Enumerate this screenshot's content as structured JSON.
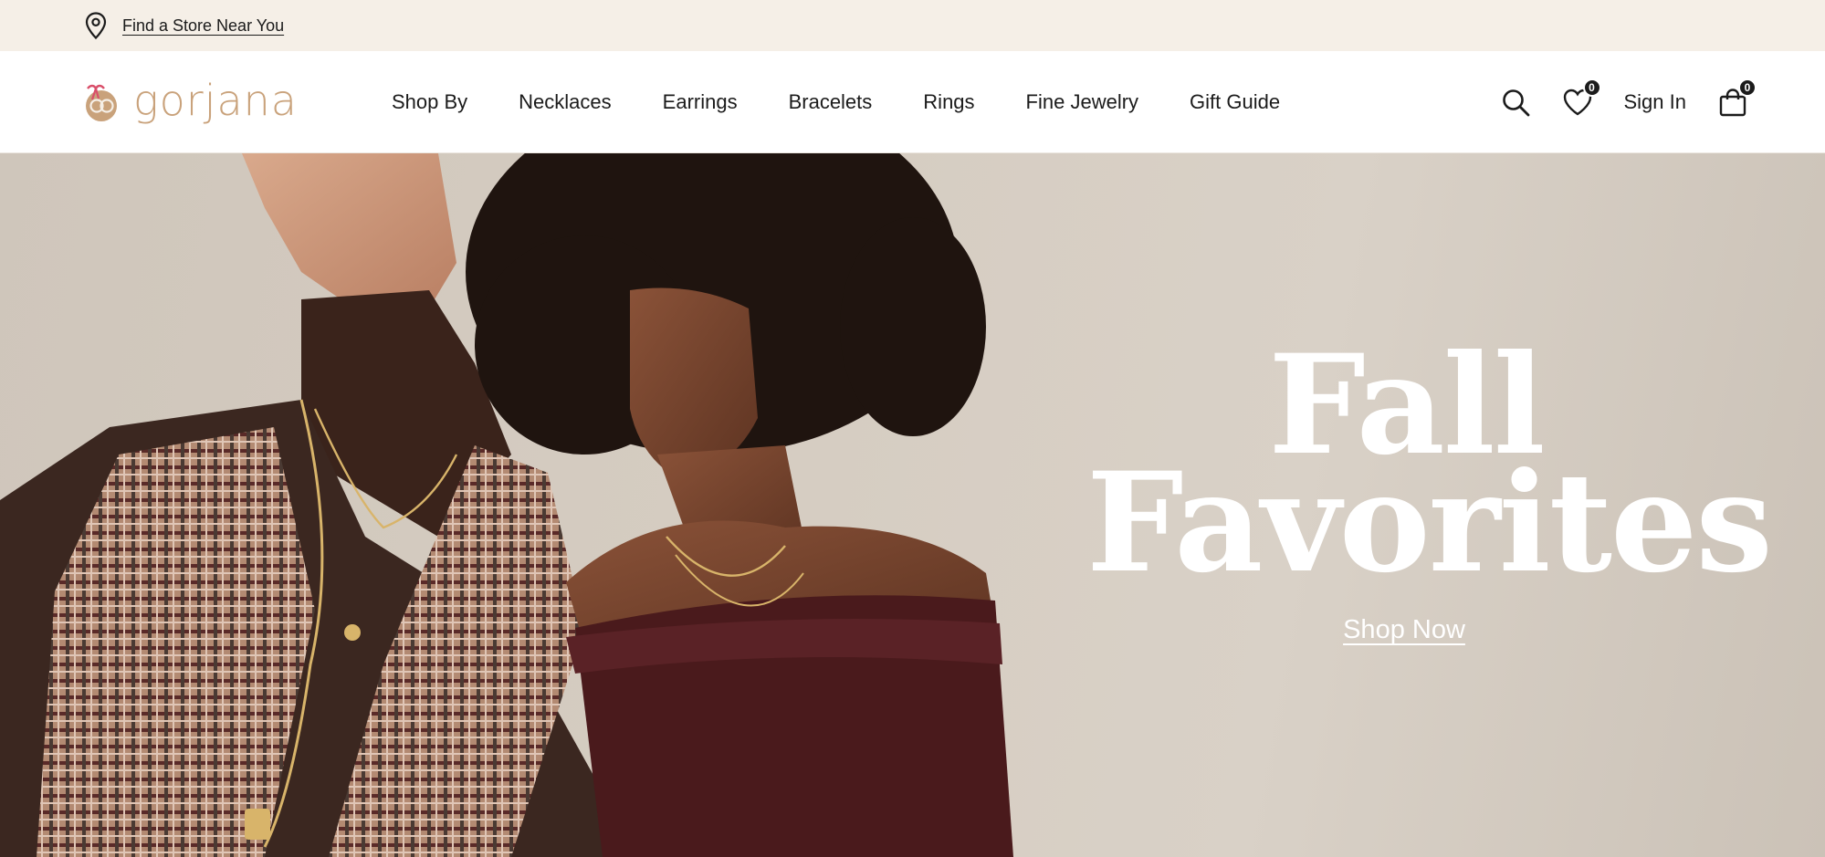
{
  "utility_bar": {
    "store_link": "Find a Store Near You",
    "icon": "map-pin-icon"
  },
  "header": {
    "logo_text": "gorjana",
    "nav": [
      {
        "label": "Shop By"
      },
      {
        "label": "Necklaces"
      },
      {
        "label": "Earrings"
      },
      {
        "label": "Bracelets"
      },
      {
        "label": "Rings"
      },
      {
        "label": "Fine Jewelry"
      },
      {
        "label": "Gift Guide"
      }
    ],
    "actions": {
      "search_icon": "search-icon",
      "wishlist_icon": "heart-icon",
      "wishlist_count": "0",
      "sign_in": "Sign In",
      "bag_icon": "shopping-bag-icon",
      "bag_count": "0"
    }
  },
  "hero": {
    "headline_line1": "Fall",
    "headline_line2": "Favorites",
    "cta": "Shop Now"
  },
  "colors": {
    "utility_bg": "#f5efe7",
    "brand": "#c9a27b",
    "logo_accent": "#d94f6a",
    "text": "#1b1b1b",
    "hero_bg": "#d6cdc2",
    "hero_text": "#ffffff"
  }
}
